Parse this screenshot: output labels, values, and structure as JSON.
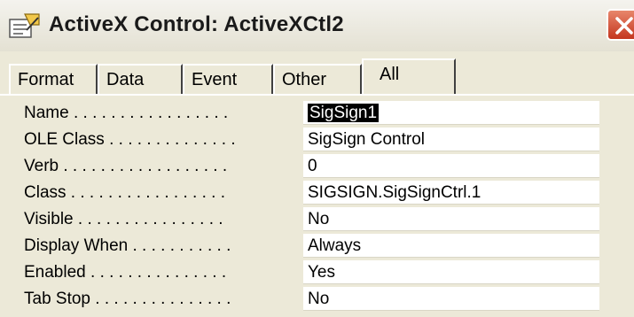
{
  "window": {
    "title": "ActiveX Control: ActiveXCtl2"
  },
  "tabs": [
    {
      "label": "Format"
    },
    {
      "label": "Data"
    },
    {
      "label": "Event"
    },
    {
      "label": "Other"
    },
    {
      "label": "All",
      "active": true
    }
  ],
  "properties": [
    {
      "label": "Name . . . . . . . . . . . . . . . . .",
      "value": "SigSign1",
      "selected": true
    },
    {
      "label": "OLE Class . . . . . . . . . . . . . .",
      "value": "SigSign Control"
    },
    {
      "label": "Verb . . . . . . . . . . . . . . . . . .",
      "value": "0"
    },
    {
      "label": "Class . . . . . . . . . . . . . . . . .",
      "value": "SIGSIGN.SigSignCtrl.1"
    },
    {
      "label": "Visible . . . . . . . . . . . . . . . .",
      "value": "No"
    },
    {
      "label": "Display When . . . . . . . . . . .",
      "value": "Always"
    },
    {
      "label": "Enabled . . . . . . . . . . . . . . .",
      "value": "Yes"
    },
    {
      "label": "Tab Stop . . . . . . . . . . . . . . .",
      "value": "No"
    }
  ],
  "colors": {
    "dialog_bg": "#ece9d8",
    "close_button": "#c4361f",
    "selection": "#000000"
  },
  "icons": {
    "title": "properties-sheet-icon",
    "close": "close-icon"
  }
}
